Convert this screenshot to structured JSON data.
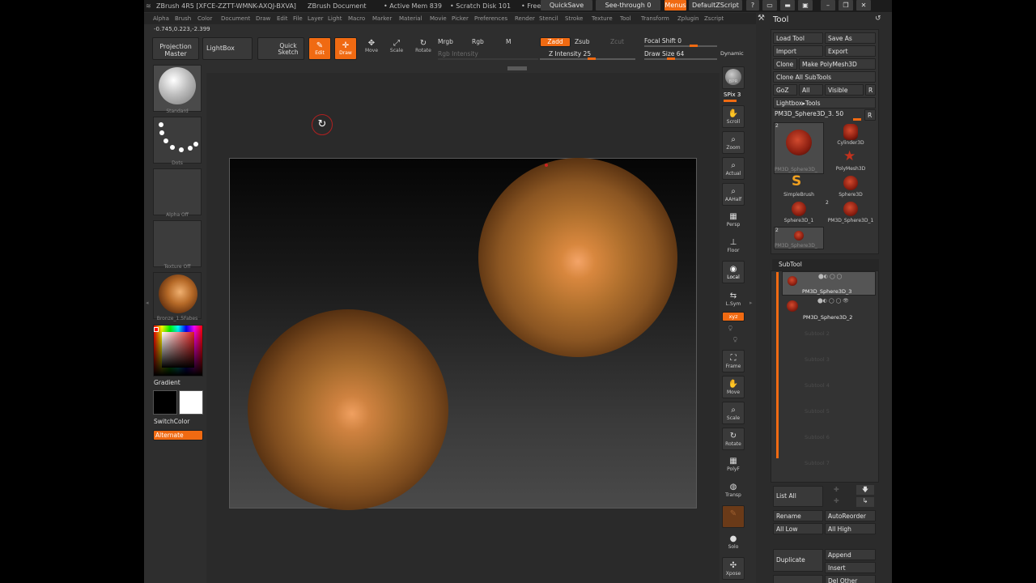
{
  "titlebar": {
    "app_title": "ZBrush 4R5 [XFCE-ZZTT-WMNK-AXQJ-BXVA]",
    "document": "ZBrush Document",
    "active_mem": "• Active Mem 839",
    "scratch_disk": "• Scratch Disk 101",
    "free": "• Free",
    "quicksave": "QuickSave",
    "see_through": "See-through  0",
    "menus": "Menus",
    "script": "DefaultZScript"
  },
  "menubar": [
    "Alpha",
    "Brush",
    "Color",
    "Document",
    "Draw",
    "Edit",
    "File",
    "Layer",
    "Light",
    "Macro",
    "Marker",
    "Material",
    "Movie",
    "Picker",
    "Preferences",
    "Render",
    "Stencil",
    "Stroke",
    "Texture",
    "Tool",
    "Transform",
    "Zplugin",
    "Zscript"
  ],
  "coords": "-0.745,0.223,-2.399",
  "toolbar": {
    "projection_master": "Projection Master",
    "lightbox": "LightBox",
    "quick_sketch": "Quick Sketch",
    "edit": "Edit",
    "draw": "Draw",
    "move": "Move",
    "scale": "Scale",
    "rotate": "Rotate",
    "mrgb": "Mrgb",
    "rgb": "Rgb",
    "m": "M",
    "rgb_intensity": "Rgb Intensity",
    "zadd": "Zadd",
    "zsub": "Zsub",
    "zcut": "Zcut",
    "z_intensity": "Z Intensity 25",
    "focal_shift": "Focal Shift 0",
    "draw_size": "Draw Size 64",
    "dynamic": "Dynamic"
  },
  "left": {
    "brush_caption": "Standard",
    "stroke_caption": "Dots",
    "alpha_caption": "Alpha  Off",
    "texture_caption": "Texture  Off",
    "material_caption": "Bronze_1.5Fabes",
    "gradient": "Gradient",
    "switchcolor": "SwitchColor",
    "alternate": "Alternate"
  },
  "rightshelf": {
    "bpr": "BPR",
    "spix": "SPix 3",
    "scroll": "Scroll",
    "zoom": "Zoom",
    "actual": "Actual",
    "aahalf": "AAHalf",
    "persp": "Persp",
    "floor": "Floor",
    "local": "Local",
    "lsym": "L.Sym",
    "xyz": "xyz",
    "frame": "Frame",
    "move": "Move",
    "scale": "Scale",
    "rotate": "Rotate",
    "polyf": "PolyF",
    "transp": "Transp",
    "solo": "Solo",
    "xpose": "Xpose"
  },
  "tool_panel": {
    "title": "Tool",
    "load_tool": "Load Tool",
    "save_as": "Save As",
    "import": "Import",
    "export": "Export",
    "clone": "Clone",
    "make_polymesh": "Make PolyMesh3D",
    "clone_all": "Clone  All SubTools",
    "goz": "GoZ",
    "all": "All",
    "visible": "Visible",
    "r": "R",
    "lightbox_tools": "Lightbox▸Tools",
    "current_tool": "PM3D_Sphere3D_3. 50",
    "tools": [
      {
        "label": "PM3D_Sphere3D_",
        "badge": "2"
      },
      {
        "label": "Cylinder3D",
        "badge": ""
      },
      {
        "label": "PolyMesh3D",
        "badge": ""
      },
      {
        "label": "SimpleBrush",
        "badge": ""
      },
      {
        "label": "Sphere3D",
        "badge": ""
      },
      {
        "label": "Sphere3D_1",
        "badge": ""
      },
      {
        "label": "PM3D_Sphere3D_1",
        "badge": "2"
      },
      {
        "label": "PM3D_Sphere3D_",
        "badge": "2"
      }
    ],
    "subtool_title": "SubTool",
    "subtools": [
      "PM3D_Sphere3D_3",
      "PM3D_Sphere3D_2"
    ],
    "empty_slots": [
      "Subtool 2",
      "Subtool 3",
      "Subtool 4",
      "Subtool 5",
      "Subtool 6",
      "Subtool 7"
    ],
    "list_all": "List  All",
    "rename": "Rename",
    "autoreorder": "AutoReorder",
    "all_low": "All Low",
    "all_high": "All High",
    "duplicate": "Duplicate",
    "append": "Append",
    "insert": "Insert",
    "del_other": "Del Other"
  },
  "colors": {
    "accent": "#f06a12",
    "background": "#2e2e2e"
  }
}
